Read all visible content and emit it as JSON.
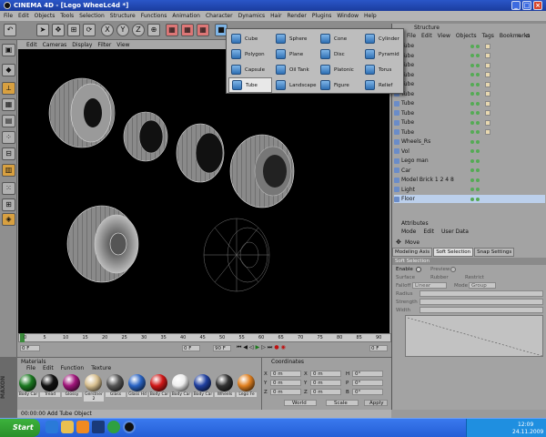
{
  "window": {
    "title": "CINEMA 4D - [Lego WheeLc4d *]"
  },
  "menu": [
    "File",
    "Edit",
    "Objects",
    "Tools",
    "Selection",
    "Structure",
    "Functions",
    "Animation",
    "Character",
    "Dynamics",
    "Hair",
    "Render",
    "Plugins",
    "Window",
    "Help"
  ],
  "viewport_menu": [
    "Edit",
    "Cameras",
    "Display",
    "Filter",
    "View"
  ],
  "dropdown": {
    "items": [
      {
        "label": "Cube",
        "icon": "cube-icon"
      },
      {
        "label": "Sphere",
        "icon": "sphere-icon"
      },
      {
        "label": "Cone",
        "icon": "cone-icon"
      },
      {
        "label": "Cylinder",
        "icon": "cylinder-icon"
      },
      {
        "label": "Polygon",
        "icon": "polygon-icon"
      },
      {
        "label": "Plane",
        "icon": "plane-icon"
      },
      {
        "label": "Disc",
        "icon": "disc-icon"
      },
      {
        "label": "Pyramid",
        "icon": "pyramid-icon"
      },
      {
        "label": "Capsule",
        "icon": "capsule-icon"
      },
      {
        "label": "Oil Tank",
        "icon": "oil-tank-icon"
      },
      {
        "label": "Platonic",
        "icon": "platonic-icon"
      },
      {
        "label": "Torus",
        "icon": "torus-icon"
      },
      {
        "label": "Tube",
        "icon": "tube-icon"
      },
      {
        "label": "Landscape",
        "icon": "landscape-icon"
      },
      {
        "label": "Figure",
        "icon": "figure-icon"
      },
      {
        "label": "Relief",
        "icon": "relief-icon"
      }
    ],
    "selected": "Tube"
  },
  "objects": {
    "header": "Structure",
    "menu": [
      "File",
      "Edit",
      "View",
      "Objects",
      "Tags",
      "Bookmarks"
    ],
    "rows": [
      "Tube",
      "Tube",
      "Tube",
      "Tube",
      "Tube",
      "Tube",
      "Tube",
      "Tube",
      "Tube",
      "Tube",
      "Wheels_Rs",
      "Vol",
      "Lego man",
      "Car",
      "Model Brick 1 2 4 8",
      "Light",
      "Floor"
    ]
  },
  "attributes": {
    "header": "Attributes",
    "menu": [
      "Mode",
      "Edit",
      "User Data"
    ],
    "object": "Move",
    "tabs": [
      "Modeling Axis",
      "Soft Selection",
      "Snap Settings"
    ],
    "active_tab": "Soft Selection",
    "section": "Soft Selection",
    "fields": {
      "enable": "Enable",
      "preview": "Preview",
      "surface": "Surface",
      "rubber": "Rubber",
      "restrict": "Restrict",
      "falloff": "Falloff",
      "falloff_val": "Linear",
      "mode": "Mode",
      "mode_val": "Group",
      "radius": "Radius",
      "strength": "Strength",
      "width": "Width"
    }
  },
  "timeline": {
    "ticks": [
      "0",
      "5",
      "10",
      "15",
      "20",
      "25",
      "30",
      "35",
      "40",
      "45",
      "50",
      "55",
      "60",
      "65",
      "70",
      "75",
      "80",
      "85",
      "90"
    ],
    "current": "0 F",
    "start": "0 F",
    "end": "90 F",
    "end_right": "0 F"
  },
  "materials": {
    "header": "Materials",
    "menu": [
      "File",
      "Edit",
      "Function",
      "Texture"
    ],
    "items": [
      {
        "label": "Body Car",
        "color": "#1c7a22"
      },
      {
        "label": "Tread",
        "color": "#111111"
      },
      {
        "label": "Glossy",
        "color": "#a0157a"
      },
      {
        "label": "Gerstner 2",
        "color": "#d8c090"
      },
      {
        "label": "Glass",
        "color": "#555555"
      },
      {
        "label": "Glass Hd",
        "color": "#2a64c4"
      },
      {
        "label": "Body Car",
        "color": "#d01818"
      },
      {
        "label": "Body Car",
        "color": "#eeeeee"
      },
      {
        "label": "Body Car",
        "color": "#2040a0"
      },
      {
        "label": "Wheels",
        "color": "#333333"
      },
      {
        "label": "Lego Fe",
        "color": "#e08020"
      }
    ]
  },
  "coordinates": {
    "header": "Coordinates",
    "rows": [
      {
        "axis": "X",
        "val": "0 m",
        "axis2": "X",
        "val2": "0 m",
        "axis3": "H",
        "val3": "0°"
      },
      {
        "axis": "Y",
        "val": "0 m",
        "axis2": "Y",
        "val2": "0 m",
        "axis3": "P",
        "val3": "0°"
      },
      {
        "axis": "Z",
        "val": "0 m",
        "axis2": "Z",
        "val2": "0 m",
        "axis3": "B",
        "val3": "0°"
      }
    ],
    "mode1": "World",
    "mode2": "Scale",
    "apply": "Apply"
  },
  "status": "00:00:00   Add Tube Object",
  "taskbar": {
    "start": "Start",
    "time": "12:09",
    "date": "24.11.2009"
  },
  "colors": {
    "viewport": "#000000",
    "panel": "#a3a3a3",
    "accent": "#2a56c8"
  }
}
